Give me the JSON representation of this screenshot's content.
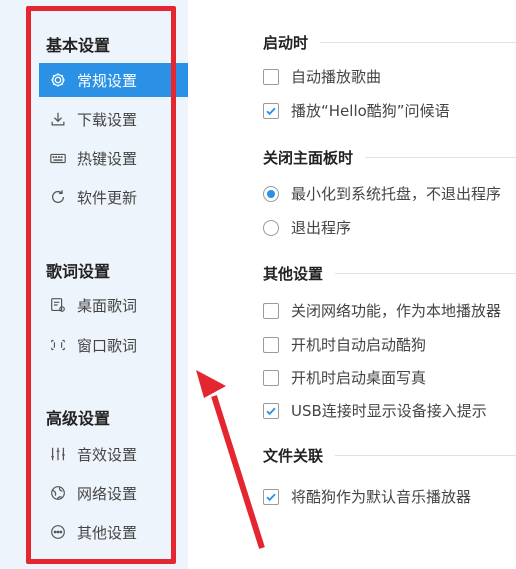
{
  "sidebar": {
    "groups": [
      {
        "title": "基本设置",
        "items": [
          {
            "label": "常规设置",
            "icon": "settings-gear-icon",
            "active": true
          },
          {
            "label": "下载设置",
            "icon": "download-icon",
            "active": false
          },
          {
            "label": "热键设置",
            "icon": "keyboard-icon",
            "active": false
          },
          {
            "label": "软件更新",
            "icon": "refresh-icon",
            "active": false
          }
        ]
      },
      {
        "title": "歌词设置",
        "items": [
          {
            "label": "桌面歌词",
            "icon": "desktop-lyrics-icon",
            "active": false
          },
          {
            "label": "窗口歌词",
            "icon": "window-lyrics-icon",
            "active": false
          }
        ]
      },
      {
        "title": "高级设置",
        "items": [
          {
            "label": "音效设置",
            "icon": "equalizer-icon",
            "active": false
          },
          {
            "label": "网络设置",
            "icon": "globe-icon",
            "active": false
          },
          {
            "label": "其他设置",
            "icon": "more-icon",
            "active": false
          }
        ]
      }
    ]
  },
  "main": {
    "sections": [
      {
        "title": "启动时",
        "options": [
          {
            "type": "checkbox",
            "label": "自动播放歌曲",
            "checked": false
          },
          {
            "type": "checkbox",
            "label": "播放“Hello酷狗”问候语",
            "checked": true
          }
        ]
      },
      {
        "title": "关闭主面板时",
        "options": [
          {
            "type": "radio",
            "label": "最小化到系统托盘，不退出程序",
            "checked": true
          },
          {
            "type": "radio",
            "label": "退出程序",
            "checked": false
          }
        ]
      },
      {
        "title": "其他设置",
        "options": [
          {
            "type": "checkbox",
            "label": "关闭网络功能，作为本地播放器",
            "checked": false
          },
          {
            "type": "checkbox",
            "label": "开机时自动启动酷狗",
            "checked": false
          },
          {
            "type": "checkbox",
            "label": "开机时启动桌面写真",
            "checked": false
          },
          {
            "type": "checkbox",
            "label": "USB连接时显示设备接入提示",
            "checked": true
          }
        ]
      },
      {
        "title": "文件关联",
        "options": [
          {
            "type": "checkbox",
            "label": "将酷狗作为默认音乐播放器",
            "checked": true
          }
        ]
      }
    ]
  },
  "colors": {
    "accent": "#2a91e6",
    "highlight_border": "#e3262f",
    "sidebar_bg": "#eef4fb"
  }
}
